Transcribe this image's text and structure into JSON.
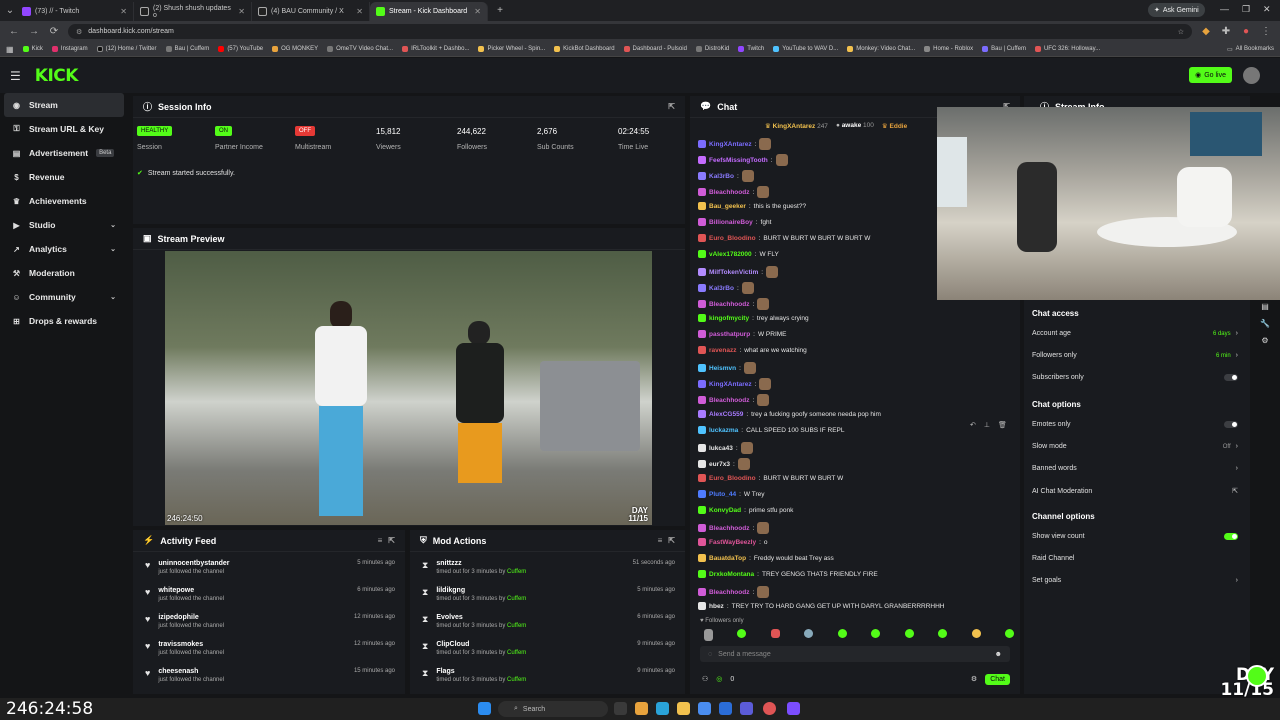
{
  "browser": {
    "tabs": [
      {
        "title": "(73) // - Twitch"
      },
      {
        "title": "(2) Shush shush updates o"
      },
      {
        "title": "(4) BAU Community / X"
      },
      {
        "title": "Stream - Kick Dashboard"
      }
    ],
    "url": "dashboard.kick.com/stream",
    "ask_gemini": "Ask Gemini",
    "bookmarks": [
      "Kick",
      "Instagram",
      "(12) Home / Twitter",
      "Bau | Cuffem",
      "(57) YouTube",
      "OG MONKEY",
      "OmeTV Video Chat...",
      "IRLToolkit + Dashbo...",
      "Picker Wheel - Spin...",
      "KickBot Dashboard",
      "Dashboard - Pulsoid",
      "DistroKid",
      "Twitch",
      "YouTube to WAV D...",
      "Monkey: Video Chat...",
      "Home - Roblox",
      "Bau | Cuffem",
      "UFC 326: Holloway..."
    ],
    "all_bookmarks": "All Bookmarks"
  },
  "header": {
    "logo": "KICK",
    "go_live": "Go live"
  },
  "sidebar": {
    "items": [
      {
        "label": "Stream",
        "icon": "signal-icon"
      },
      {
        "label": "Stream URL & Key",
        "icon": "key-icon"
      },
      {
        "label": "Advertisement",
        "icon": "megaphone-icon",
        "badge": "Beta"
      },
      {
        "label": "Revenue",
        "icon": "dollar-icon"
      },
      {
        "label": "Achievements",
        "icon": "trophy-icon"
      },
      {
        "label": "Studio",
        "icon": "video-icon"
      },
      {
        "label": "Analytics",
        "icon": "chart-icon"
      },
      {
        "label": "Moderation",
        "icon": "hammer-icon"
      },
      {
        "label": "Community",
        "icon": "users-icon"
      },
      {
        "label": "Drops & rewards",
        "icon": "gift-icon"
      }
    ]
  },
  "session": {
    "title": "Session Info",
    "stats": [
      {
        "value": "HEALTHY",
        "label": "Session"
      },
      {
        "value": "ON",
        "label": "Partner Income"
      },
      {
        "value": "OFF",
        "label": "Multistream"
      },
      {
        "value": "15,812",
        "label": "Viewers"
      },
      {
        "value": "244,622",
        "label": "Followers"
      },
      {
        "value": "2,676",
        "label": "Sub Counts"
      },
      {
        "value": "02:24:55",
        "label": "Time Live"
      }
    ],
    "status": "Stream started successfully."
  },
  "preview": {
    "title": "Stream Preview",
    "timer": "246:24:50",
    "day_line1": "DAY",
    "day_line2": "11/15"
  },
  "activity": {
    "title": "Activity Feed",
    "items": [
      {
        "name": "uninnocentbystander",
        "action": "just followed the channel",
        "time": "5 minutes ago"
      },
      {
        "name": "whitepowe",
        "action": "just followed the channel",
        "time": "6 minutes ago"
      },
      {
        "name": "izipedophile",
        "action": "just followed the channel",
        "time": "12 minutes ago"
      },
      {
        "name": "travissmokes",
        "action": "just followed the channel",
        "time": "12 minutes ago"
      },
      {
        "name": "cheesenash",
        "action": "just followed the channel",
        "time": "15 minutes ago"
      }
    ]
  },
  "mod": {
    "title": "Mod Actions",
    "by": "Cuffem",
    "items": [
      {
        "name": "snittzzz",
        "action": "timed out for 3 minutes by",
        "time": "51 seconds ago"
      },
      {
        "name": "lildikgng",
        "action": "timed out for 3 minutes by",
        "time": "5 minutes ago"
      },
      {
        "name": "Evolves",
        "action": "timed out for 3 minutes by",
        "time": "6 minutes ago"
      },
      {
        "name": "ClipCloud",
        "action": "timed out for 3 minutes by",
        "time": "9 minutes ago"
      },
      {
        "name": "Flags",
        "action": "timed out for 3 minutes by",
        "time": "9 minutes ago"
      }
    ]
  },
  "chat": {
    "title": "Chat",
    "pinned": [
      {
        "name": "KingXAntarez",
        "count": "247"
      },
      {
        "name": "awake",
        "count": "100"
      },
      {
        "name": "Eddie"
      }
    ],
    "messages": [
      {
        "user": "KingXAntarez",
        "text": "",
        "color": "#7b6cff"
      },
      {
        "user": "FeefsMissingTooth",
        "text": "",
        "color": "#c46bff"
      },
      {
        "user": "Kal3rBo",
        "text": "",
        "color": "#8a7bff"
      },
      {
        "user": "Bleachhoodz",
        "text": "",
        "color": "#d05cd8"
      },
      {
        "user": "Bau_geeker",
        "text": "this is the guest??",
        "color": "#f2c14e"
      },
      {
        "user": "BillionaireBoy",
        "text": "fght",
        "color": "#d05cd8"
      },
      {
        "user": "Euro_Bloodino",
        "text": "BURT W BURT W BURT W BURT W",
        "color": "#e05555"
      },
      {
        "user": "vAlex1782000",
        "text": "W FLY",
        "color": "#53fc18"
      },
      {
        "user": "MilfTokenVictim",
        "text": "",
        "color": "#b38cff"
      },
      {
        "user": "Kal3rBo",
        "text": "",
        "color": "#8a7bff"
      },
      {
        "user": "Bleachhoodz",
        "text": "",
        "color": "#d05cd8"
      },
      {
        "user": "kingofmycity",
        "text": "trey always crying",
        "color": "#53fc18"
      },
      {
        "user": "passthatpurp",
        "text": "W PRIME",
        "color": "#d05cd8"
      },
      {
        "user": "ravenazz",
        "text": "what are we watching",
        "color": "#e05555"
      },
      {
        "user": "Heismvn",
        "text": "",
        "color": "#4fc3ff"
      },
      {
        "user": "KingXAntarez",
        "text": "",
        "color": "#7b6cff"
      },
      {
        "user": "Bleachhoodz",
        "text": "",
        "color": "#d05cd8"
      },
      {
        "user": "AlexCG559",
        "text": "trey a fucking goofy someone needa pop him",
        "color": "#a87bff"
      },
      {
        "user": "luckazma",
        "text": "CALL SPEED 100 SUBS IF REPL",
        "color": "#4fc3ff"
      },
      {
        "user": "lukca43",
        "text": "",
        "color": "#e6e6e6"
      },
      {
        "user": "eur7x3",
        "text": "",
        "color": "#e6e6e6"
      },
      {
        "user": "Euro_Bloodino",
        "text": "BURT W BURT W BURT W",
        "color": "#e05555"
      },
      {
        "user": "Pluto_44",
        "text": "W Trey",
        "color": "#4f7cff"
      },
      {
        "user": "KonvyDad",
        "text": "prime stfu ponk",
        "color": "#53fc18"
      },
      {
        "user": "Bleachhoodz",
        "text": "",
        "color": "#d05cd8"
      },
      {
        "user": "FastWayBeezly",
        "text": "o",
        "color": "#e05599"
      },
      {
        "user": "BauatdaTop",
        "text": "Freddy would beat Trey ass",
        "color": "#f2c14e"
      },
      {
        "user": "DrxkoMontana",
        "text": "TREY GENGG THATS FRIENDLY FIRE",
        "color": "#53fc18"
      },
      {
        "user": "Bleachhoodz",
        "text": "",
        "color": "#d05cd8"
      },
      {
        "user": "hbez",
        "text": "TREY TRY TO HARD GANG GET UP WITH DARYL GRANBERRRRHHH",
        "color": "#e6e6e6"
      }
    ],
    "followers_only": "Followers only",
    "input_placeholder": "Send a message",
    "counter": "0",
    "send_label": "Chat"
  },
  "right": {
    "stream_info_title": "Stream Info",
    "chat_access_title": "Chat access",
    "account_age": {
      "label": "Account age",
      "value": "6 days"
    },
    "followers_only": {
      "label": "Followers only",
      "value": "6 min"
    },
    "subscribers_only": {
      "label": "Subscribers only"
    },
    "chat_options_title": "Chat options",
    "emotes_only": {
      "label": "Emotes only"
    },
    "slow_mode": {
      "label": "Slow mode",
      "value": "Off"
    },
    "banned_words": {
      "label": "Banned words"
    },
    "ai_moderation": {
      "label": "AI Chat Moderation"
    },
    "channel_options_title": "Channel options",
    "show_view_count": {
      "label": "Show view count"
    },
    "raid_channel": {
      "label": "Raid Channel"
    },
    "set_goals": {
      "label": "Set goals"
    }
  },
  "taskbar": {
    "clock": "246:24:58",
    "search": "Search"
  },
  "overlay": {
    "day_line1": "DAY",
    "day_line2": "11/15"
  },
  "colors": {
    "accent": "#53fc18",
    "bg": "#141517",
    "panel": "#191b1f"
  }
}
